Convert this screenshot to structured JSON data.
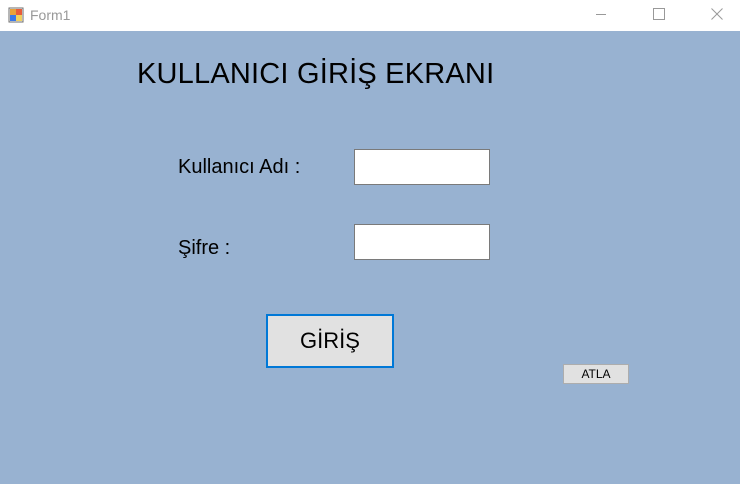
{
  "window": {
    "title": "Form1",
    "controls": [
      "minimize",
      "maximize",
      "close"
    ]
  },
  "form": {
    "heading": "KULLANICI GİRİŞ EKRANI",
    "username_label": "Kullanıcı Adı :",
    "username_value": "",
    "password_label": "Şifre :",
    "password_value": "",
    "login_button": "GİRİŞ",
    "skip_button": "ATLA"
  },
  "colors": {
    "client_background": "#98b2d1",
    "button_face": "#e1e1e1",
    "focus_border": "#0078d7"
  },
  "icons": {
    "app": "winforms-app-icon",
    "minimize": "minimize-icon",
    "maximize": "maximize-icon",
    "close": "close-icon"
  }
}
